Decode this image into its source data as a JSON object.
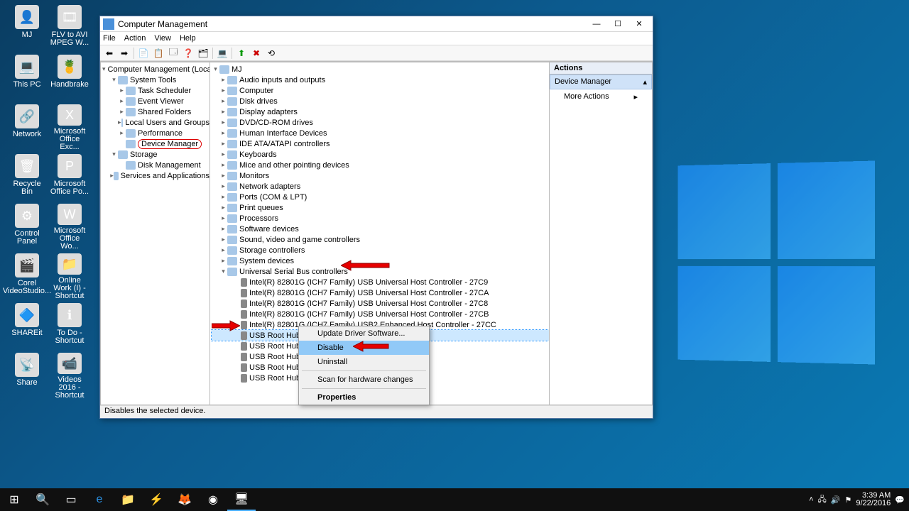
{
  "desktop_icons": [
    {
      "label": "MJ",
      "glyph": "👤"
    },
    {
      "label": "FLV to AVI MPEG W...",
      "glyph": "🎞"
    },
    {
      "label": "This PC",
      "glyph": "💻"
    },
    {
      "label": "Handbrake",
      "glyph": "🍍"
    },
    {
      "label": "Network",
      "glyph": "🔗"
    },
    {
      "label": "Microsoft Office Exc...",
      "glyph": "X"
    },
    {
      "label": "Recycle Bin",
      "glyph": "🗑"
    },
    {
      "label": "Microsoft Office Po...",
      "glyph": "P"
    },
    {
      "label": "Control Panel",
      "glyph": "⚙"
    },
    {
      "label": "Microsoft Office Wo...",
      "glyph": "W"
    },
    {
      "label": "Corel VideoStudio...",
      "glyph": "🎬"
    },
    {
      "label": "Online Work (I) - Shortcut",
      "glyph": "📁"
    },
    {
      "label": "SHAREit",
      "glyph": "🔷"
    },
    {
      "label": "To Do - Shortcut",
      "glyph": "ℹ"
    },
    {
      "label": "Share",
      "glyph": "📡"
    },
    {
      "label": "Videos 2016 - Shortcut",
      "glyph": "📹"
    }
  ],
  "window": {
    "title": "Computer Management",
    "menu": [
      "File",
      "Action",
      "View",
      "Help"
    ],
    "status": "Disables the selected device."
  },
  "left_tree": {
    "root": "Computer Management (Local",
    "system_tools": "System Tools",
    "st_children": [
      "Task Scheduler",
      "Event Viewer",
      "Shared Folders",
      "Local Users and Groups",
      "Performance",
      "Device Manager"
    ],
    "storage": "Storage",
    "storage_children": [
      "Disk Management"
    ],
    "services": "Services and Applications"
  },
  "mid_tree": {
    "root": "MJ",
    "cats": [
      "Audio inputs and outputs",
      "Computer",
      "Disk drives",
      "Display adapters",
      "DVD/CD-ROM drives",
      "Human Interface Devices",
      "IDE ATA/ATAPI controllers",
      "Keyboards",
      "Mice and other pointing devices",
      "Monitors",
      "Network adapters",
      "Ports (COM & LPT)",
      "Print queues",
      "Processors",
      "Software devices",
      "Sound, video and game controllers",
      "Storage controllers",
      "System devices",
      "Universal Serial Bus controllers"
    ],
    "usb_children": [
      "Intel(R) 82801G (ICH7 Family) USB Universal Host Controller - 27C9",
      "Intel(R) 82801G (ICH7 Family) USB Universal Host Controller - 27CA",
      "Intel(R) 82801G (ICH7 Family) USB Universal Host Controller - 27C8",
      "Intel(R) 82801G (ICH7 Family) USB Universal Host Controller - 27CB",
      "Intel(R) 82801G (ICH7 Family) USB2 Enhanced Host Controller - 27CC",
      "USB Root Hub",
      "USB Root Hub",
      "USB Root Hub",
      "USB Root Hub",
      "USB Root Hub"
    ],
    "selected_usb_index": 5
  },
  "context_menu": {
    "items": [
      "Update Driver Software...",
      "Disable",
      "Uninstall",
      "Scan for hardware changes",
      "Properties"
    ],
    "highlighted": "Disable",
    "bold": "Properties"
  },
  "actions": {
    "header": "Actions",
    "selected": "Device Manager",
    "more": "More Actions"
  },
  "systray": {
    "time": "3:39 AM",
    "date": "9/22/2016"
  }
}
